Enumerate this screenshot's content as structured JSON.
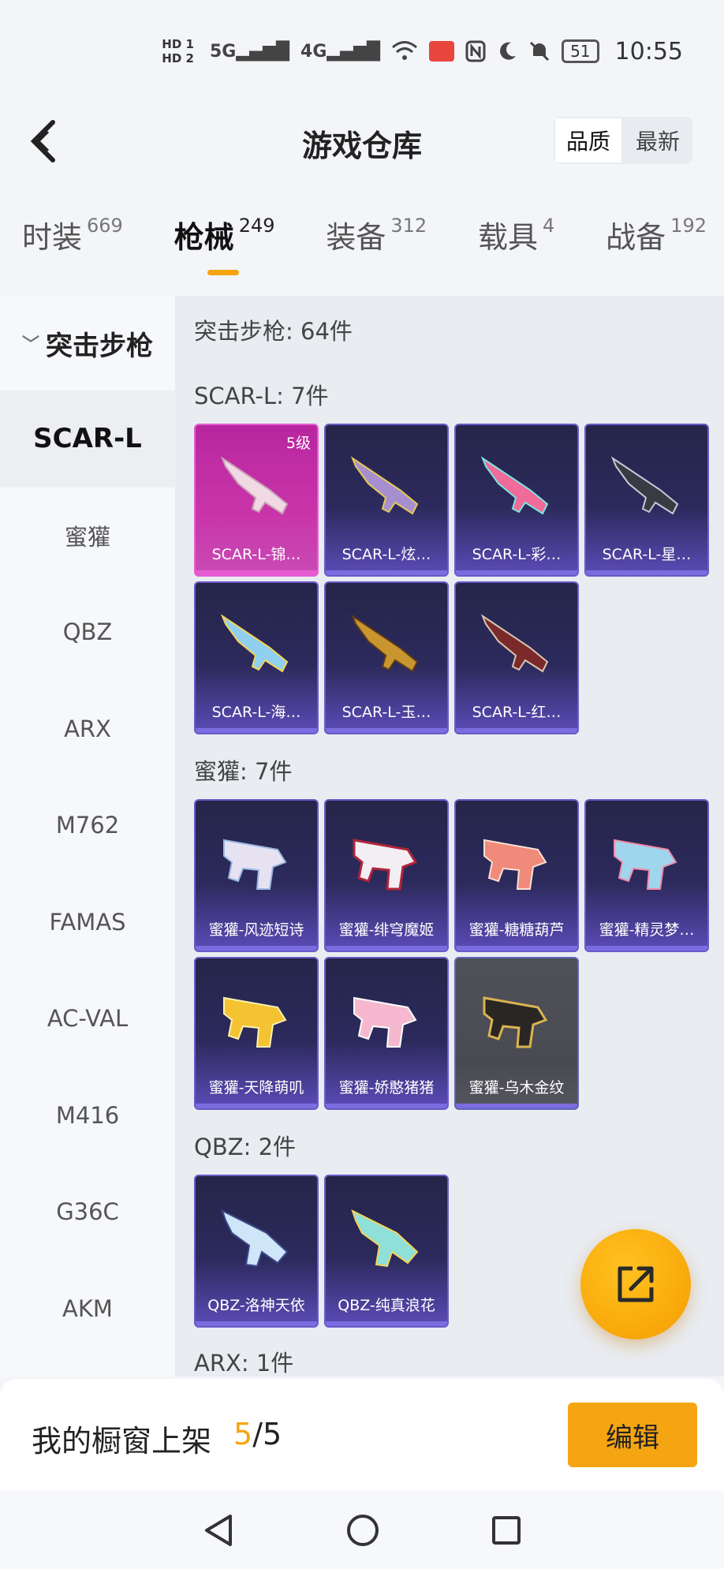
{
  "status_bar": {
    "hd1": "HD 1",
    "hd2": "HD 2",
    "net1": "5G",
    "net2": "4G",
    "battery": "51",
    "time": "10:55"
  },
  "header": {
    "title": "游戏仓库",
    "sort_options": [
      "品质",
      "最新"
    ],
    "active_sort": "品质"
  },
  "tabs": [
    {
      "label": "时装",
      "count": "669"
    },
    {
      "label": "枪械",
      "count": "249"
    },
    {
      "label": "装备",
      "count": "312"
    },
    {
      "label": "载具",
      "count": "4"
    },
    {
      "label": "战备",
      "count": "192"
    }
  ],
  "active_tab": "枪械",
  "accent_color": "#f5a512",
  "sidebar": {
    "group": "突击步枪",
    "items": [
      "SCAR-L",
      "蜜獾",
      "QBZ",
      "ARX",
      "M762",
      "FAMAS",
      "AC-VAL",
      "M416",
      "G36C",
      "AKM"
    ],
    "active": "SCAR-L"
  },
  "content": {
    "total": "突击步枪: 64件",
    "sections": [
      {
        "title": "SCAR-L: 7件",
        "cards": [
          {
            "name": "SCAR-L-锦…",
            "level": "5级",
            "rarity": "legendary"
          },
          {
            "name": "SCAR-L-炫…"
          },
          {
            "name": "SCAR-L-彩…"
          },
          {
            "name": "SCAR-L-星…"
          },
          {
            "name": "SCAR-L-海…"
          },
          {
            "name": "SCAR-L-玉…"
          },
          {
            "name": "SCAR-L-红…"
          }
        ]
      },
      {
        "title": "蜜獾: 7件",
        "cards": [
          {
            "name": "蜜獾-风迹短诗"
          },
          {
            "name": "蜜獾-绯穹魔姬"
          },
          {
            "name": "蜜獾-糖糖葫芦"
          },
          {
            "name": "蜜獾-精灵梦…"
          },
          {
            "name": "蜜獾-天降萌叽"
          },
          {
            "name": "蜜獾-娇憨猪猪"
          },
          {
            "name": "蜜獾-乌木金纹",
            "rarity": "common"
          }
        ]
      },
      {
        "title": "QBZ: 2件",
        "cards": [
          {
            "name": "QBZ-洛神天依"
          },
          {
            "name": "QBZ-纯真浪花"
          }
        ]
      },
      {
        "title": "ARX: 1件",
        "cards": []
      }
    ]
  },
  "bottom": {
    "showcase_label": "我的橱窗上架",
    "showcase_current": "5",
    "showcase_sep": "/",
    "showcase_max": "5",
    "edit_label": "编辑"
  },
  "icons": {
    "back": "chevron-left-icon",
    "share": "share-export-icon",
    "nav_back": "triangle-back-icon",
    "nav_home": "circle-home-icon",
    "nav_recent": "square-recent-icon"
  }
}
